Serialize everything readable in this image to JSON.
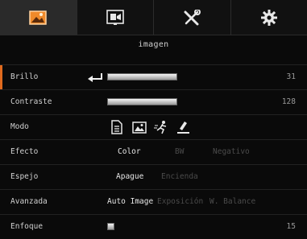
{
  "tabs": [
    {
      "icon": "image-settings-icon",
      "active": true
    },
    {
      "icon": "display-settings-icon",
      "active": false
    },
    {
      "icon": "tools-icon",
      "active": false
    },
    {
      "icon": "gear-icon",
      "active": false
    }
  ],
  "section_title": "imagen",
  "rows": {
    "brillo": {
      "label": "Brillo",
      "value": "31",
      "level": 0.25
    },
    "contraste": {
      "label": "Contraste",
      "value": "128",
      "level": 0.5
    },
    "modo": {
      "label": "Modo",
      "icons": [
        "document-mode-icon",
        "photo-mode-icon",
        "motion-mode-icon",
        "highlight-mode-icon"
      ]
    },
    "efecto": {
      "label": "Efecto",
      "options": [
        "Color",
        "BW",
        "Negativo"
      ],
      "selected": "Color"
    },
    "espejo": {
      "label": "Espejo",
      "options": [
        "Apague",
        "Encienda"
      ],
      "selected": "Apague"
    },
    "avanzada": {
      "label": "Avanzada",
      "options": [
        "Auto Image",
        "Exposición",
        "W. Balance"
      ],
      "selected": "Auto Image"
    },
    "enfoque": {
      "label": "Enfoque",
      "value": "15"
    }
  },
  "colors": {
    "accent": "#e06a1e",
    "background": "#0a0a0a",
    "inactive_text": "#4b4b4b"
  }
}
